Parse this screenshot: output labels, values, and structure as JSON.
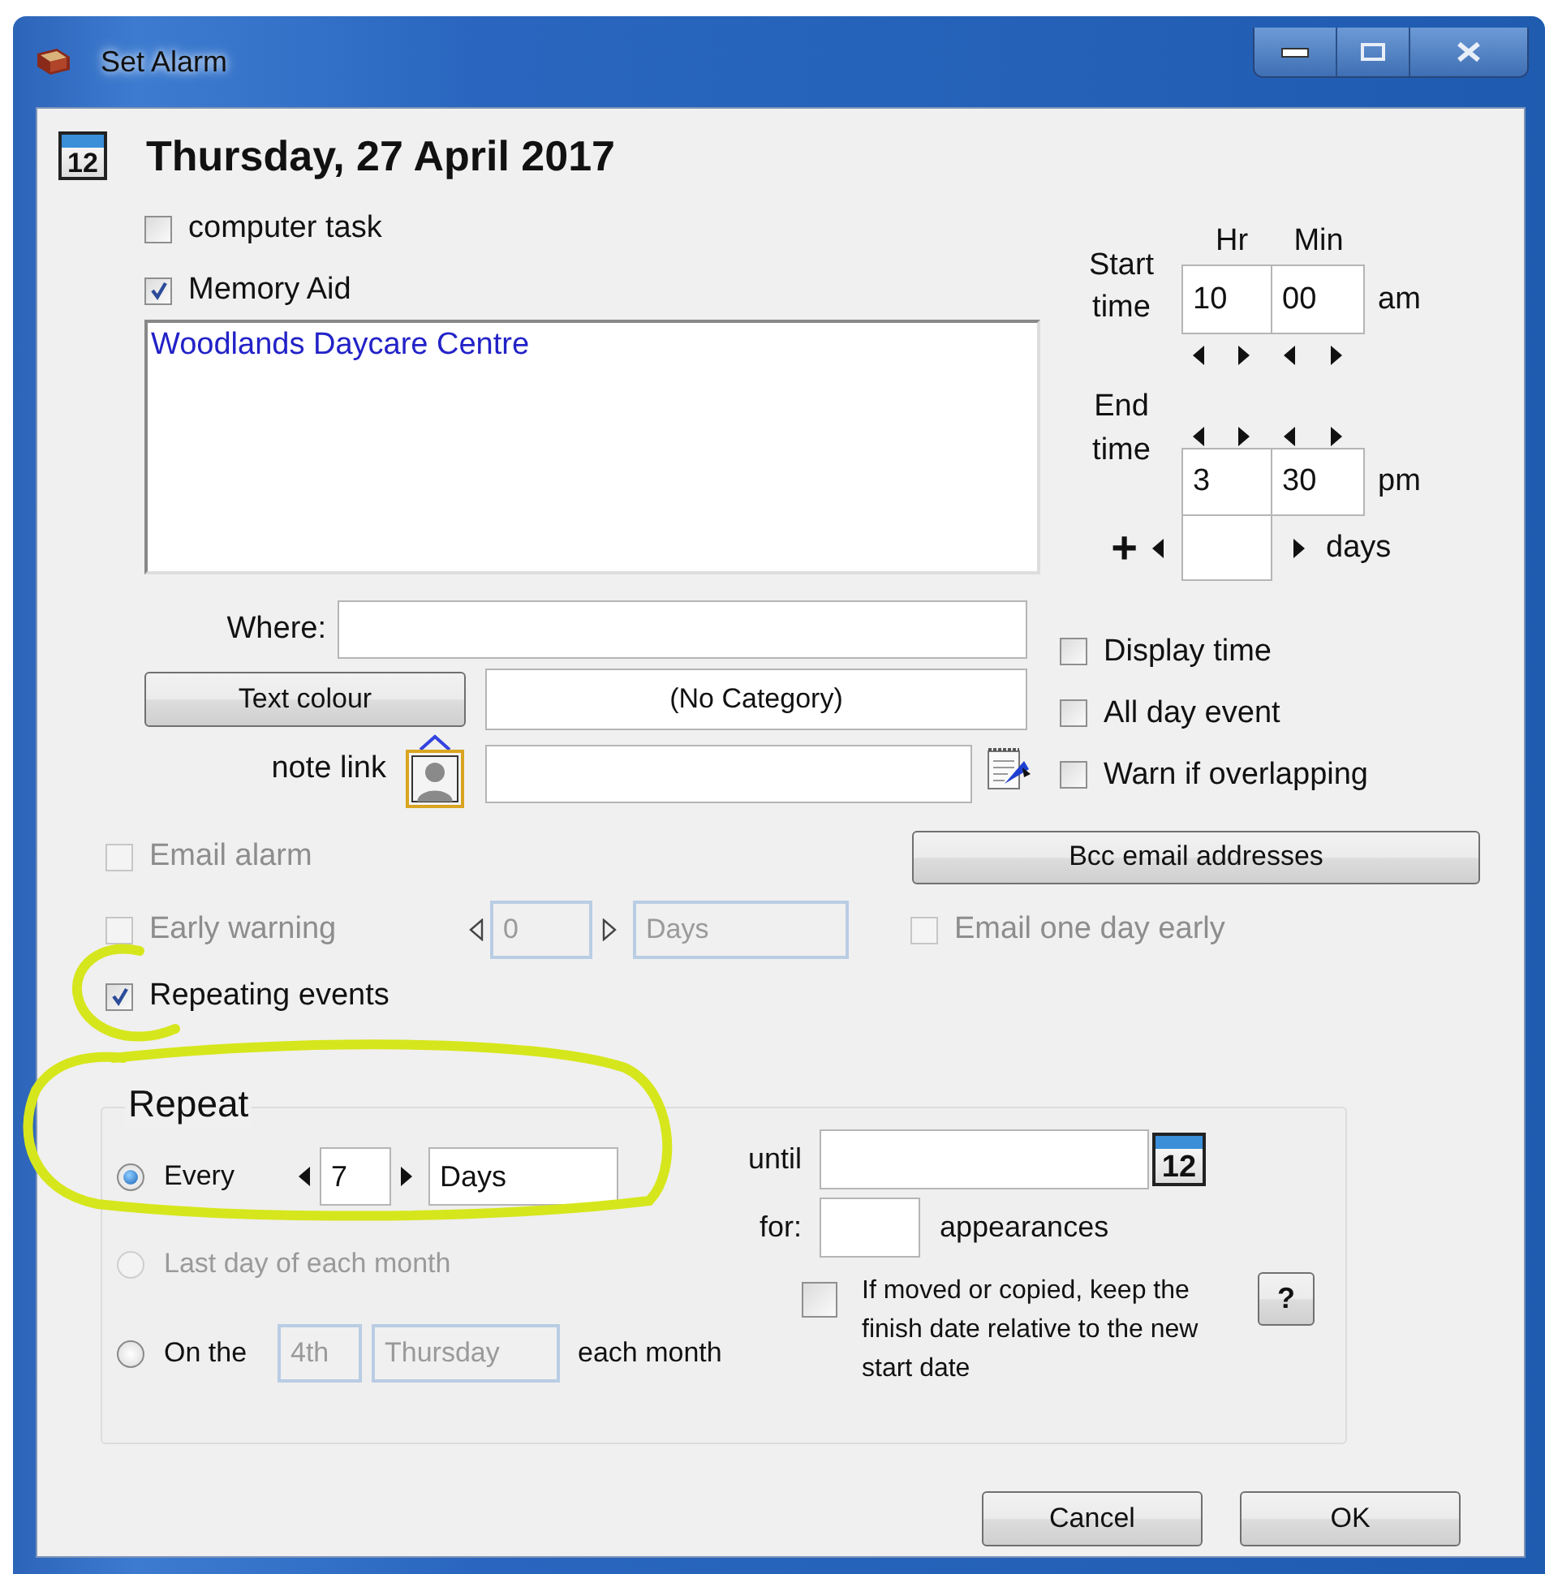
{
  "window": {
    "title": "Set Alarm"
  },
  "header": {
    "icon_text": "12",
    "date": "Thursday, 27 April 2017"
  },
  "options_top": [
    {
      "label": "computer task",
      "checked": false
    },
    {
      "label": "Memory Aid",
      "checked": true
    }
  ],
  "memo": {
    "value": "Woodlands Daycare Centre"
  },
  "time": {
    "hr_label": "Hr",
    "min_label": "Min",
    "start_label": "Start time",
    "start_hr": "10",
    "start_min": "00",
    "start_ampm": "am",
    "end_label": "End time",
    "end_hr": "3",
    "end_min": "30",
    "end_ampm": "pm",
    "plus": "+",
    "days_label": "days"
  },
  "where": {
    "label": "Where:"
  },
  "text_colour_button": "Text colour",
  "category": "(No Category)",
  "note_link": {
    "label": "note link"
  },
  "options_right": [
    {
      "label": "Display time",
      "checked": false
    },
    {
      "label": "All day event",
      "checked": false
    },
    {
      "label": "Warn if overlapping",
      "checked": false
    }
  ],
  "email_alarm": {
    "label": "Email alarm",
    "checked": false,
    "disabled": true
  },
  "bcc_button": "Bcc email addresses",
  "early_warning": {
    "label": "Early warning",
    "checked": false,
    "disabled": true,
    "value": "0",
    "unit": "Days"
  },
  "email_one_day_early": {
    "label": "Email one day early",
    "checked": false,
    "disabled": true
  },
  "repeating_events": {
    "label": "Repeating events",
    "checked": true,
    "disabled": false
  },
  "repeat": {
    "title": "Repeat",
    "options": [
      {
        "kind": "every",
        "label": "Every",
        "selected": true,
        "disabled": false,
        "value": "7",
        "unit": "Days"
      },
      {
        "kind": "plain",
        "label": "Last day of each month",
        "selected": false,
        "disabled": true
      },
      {
        "kind": "monthly",
        "label": "On the",
        "selected": false,
        "disabled": false,
        "ordinal": "4th",
        "weekday": "Thursday",
        "suffix": "each month"
      }
    ],
    "until_label": "until",
    "calendar_icon_text": "12",
    "for_label": "for:",
    "appearances_label": "appearances",
    "keep_relative": {
      "label": "If moved or copied, keep the finish date relative to the new start date",
      "checked": false
    },
    "help_button": "?"
  },
  "buttons": [
    {
      "label": "Cancel"
    },
    {
      "label": "OK"
    }
  ]
}
